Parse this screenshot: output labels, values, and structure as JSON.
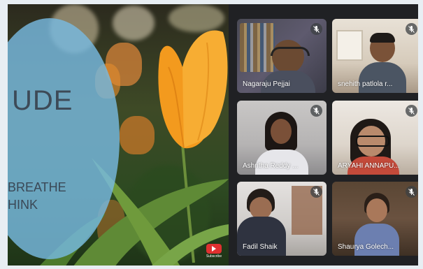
{
  "presentation": {
    "title_partial": "UDE",
    "lines": [
      "BREATHE",
      "HINK"
    ],
    "subscribe_label": "Subscribe"
  },
  "participants": [
    {
      "name": "Nagaraju Pejjai",
      "muted": true
    },
    {
      "name": "snehith patlola r...",
      "muted": true
    },
    {
      "name": "Ashritha Reddy ...",
      "muted": true
    },
    {
      "name": "ARYAHI ANNAPU...",
      "muted": true
    },
    {
      "name": "Fadil Shaik",
      "muted": true
    },
    {
      "name": "Shaurya Golech...",
      "muted": true
    }
  ],
  "colors": {
    "meet_background": "#202124",
    "tile_background": "#3c4043",
    "slide_circle": "#78b9e1",
    "tulip_orange": "#f39a1e",
    "youtube_red": "#e03030"
  },
  "icons": {
    "mute": "mic-off-icon",
    "subscribe": "youtube-icon"
  }
}
